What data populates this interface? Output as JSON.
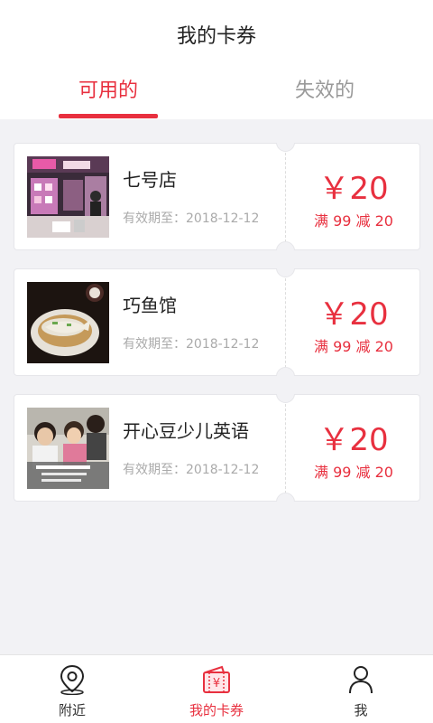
{
  "header": {
    "title": "我的卡券",
    "tabs": [
      {
        "label": "可用的",
        "active": true
      },
      {
        "label": "失效的",
        "active": false
      }
    ]
  },
  "colors": {
    "accent": "#e8303f",
    "background": "#f2f2f5"
  },
  "coupons": [
    {
      "store": "七号店",
      "expiry": "有效期至：2018-12-12",
      "amount": "￥20",
      "condition": "满 99 减 20",
      "thumb": "store-photo"
    },
    {
      "store": "巧鱼馆",
      "expiry": "有效期至：2018-12-12",
      "amount": "￥20",
      "condition": "满 99 减 20",
      "thumb": "fish-dish-photo"
    },
    {
      "store": "开心豆少儿英语",
      "expiry": "有效期至：2018-12-12",
      "amount": "￥20",
      "condition": "满 99 减 20",
      "thumb": "kids-class-photo"
    }
  ],
  "tabbar": {
    "items": [
      {
        "label": "附近",
        "icon": "location-pin-icon",
        "active": false
      },
      {
        "label": "我的卡券",
        "icon": "coupon-wallet-icon",
        "active": true
      },
      {
        "label": "我",
        "icon": "person-icon",
        "active": false
      }
    ]
  }
}
